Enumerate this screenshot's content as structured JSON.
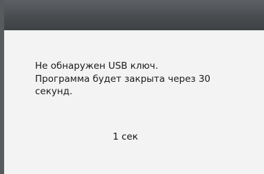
{
  "dialog": {
    "message_lines": [
      "Не обнаружен USB ключ.",
      "Программа будет закрыта через 30",
      "секунд."
    ],
    "countdown": "1 сек"
  }
}
